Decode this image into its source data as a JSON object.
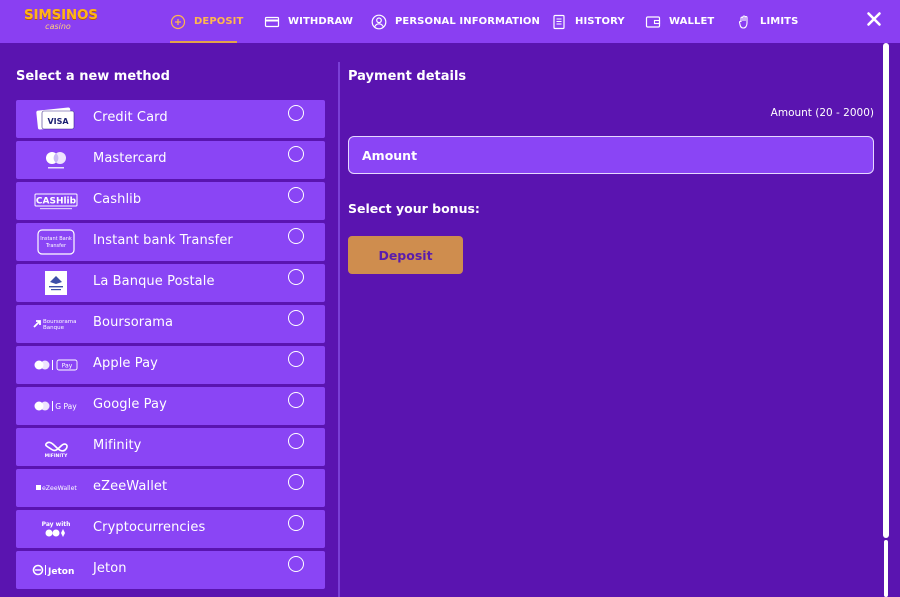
{
  "brand": {
    "name": "SIMSINOS",
    "sub": "casino"
  },
  "nav": {
    "deposit": "DEPOSIT",
    "withdraw": "WITHDRAW",
    "personal_information": "PERSONAL INFORMATION",
    "history": "HISTORY",
    "wallet": "WALLET",
    "limits": "LIMITS"
  },
  "colors": {
    "header_bg": "#8a3ff2",
    "page_bg": "#5a14b0",
    "accent_active": "#ffb84d",
    "method_bg": "#8a45f5",
    "deposit_button": "#cf8d4e"
  },
  "left": {
    "title": "Select a new method",
    "methods": [
      {
        "label": "Credit Card",
        "icon": "visa-card-icon",
        "logo_text": "VISA"
      },
      {
        "label": "Mastercard",
        "icon": "mastercard-icon"
      },
      {
        "label": "Cashlib",
        "icon": "cashlib-icon",
        "logo_text": "CASHlib"
      },
      {
        "label": "Instant bank Transfer",
        "icon": "instant-bank-transfer-icon",
        "logo_text": "Instant Bank Transfer"
      },
      {
        "label": "La Banque Postale",
        "icon": "la-banque-postale-icon"
      },
      {
        "label": "Boursorama",
        "icon": "boursorama-icon",
        "logo_text": "Boursorama Banque"
      },
      {
        "label": "Apple Pay",
        "icon": "apple-pay-icon",
        "logo_text": "Pay"
      },
      {
        "label": "Google Pay",
        "icon": "google-pay-icon",
        "logo_text": "G Pay"
      },
      {
        "label": "Mifinity",
        "icon": "mifinity-icon",
        "logo_text": "MIFINITY"
      },
      {
        "label": "eZeeWallet",
        "icon": "ezeewallet-icon",
        "logo_text": "eZeeWallet"
      },
      {
        "label": "Cryptocurrencies",
        "icon": "crypto-icon",
        "logo_text": "Pay with"
      },
      {
        "label": "Jeton",
        "icon": "jeton-icon",
        "logo_text": "Jeton"
      }
    ]
  },
  "right": {
    "title": "Payment details",
    "amount_label": "Amount (20 - 2000)",
    "amount_placeholder": "Amount",
    "bonus_title": "Select your bonus:",
    "deposit_button": "Deposit"
  }
}
